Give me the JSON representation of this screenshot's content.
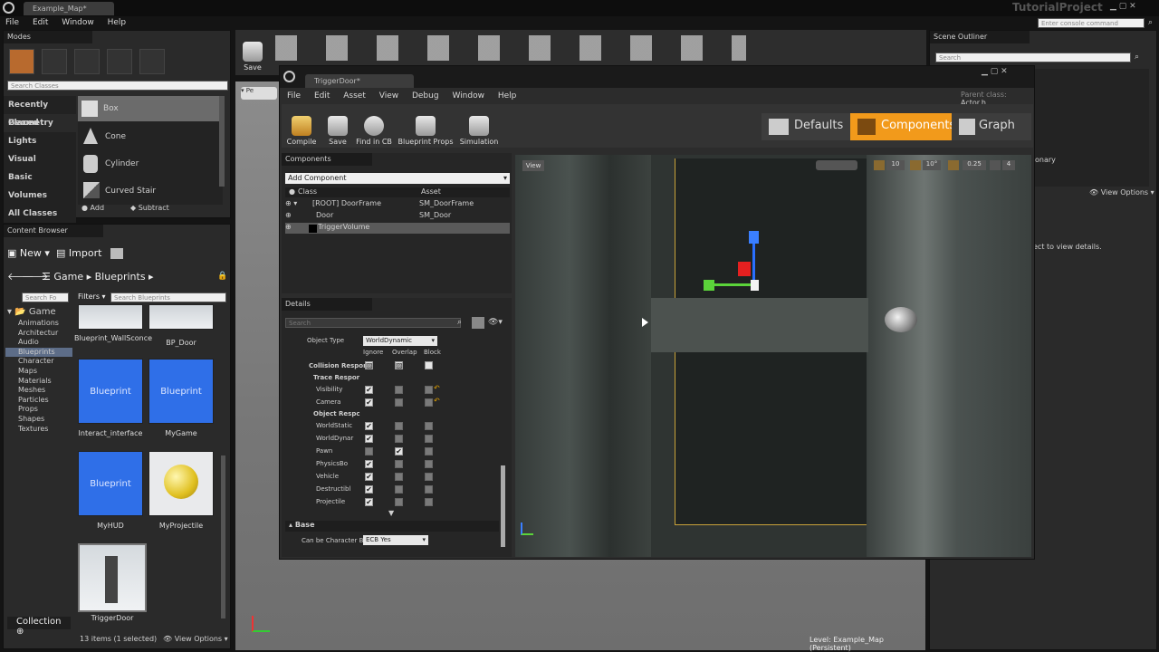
{
  "app": {
    "tab_title": "Example_Map*",
    "project": "TutorialProject",
    "console_placeholder": "Enter console command"
  },
  "main_menu": [
    "File",
    "Edit",
    "Window",
    "Help"
  ],
  "modes": {
    "title": "Modes",
    "search_placeholder": "Search Classes",
    "categories": [
      "Recently Placed",
      "Geometry",
      "Lights",
      "Visual",
      "Basic",
      "Volumes",
      "All Classes"
    ],
    "items": [
      "Box",
      "Cone",
      "Cylinder",
      "Curved Stair"
    ],
    "add_label": "Add",
    "subtract_label": "Subtract"
  },
  "toolbar": {
    "save_label": "Save"
  },
  "content_browser": {
    "title": "Content Browser",
    "new_label": "New",
    "import_label": "Import",
    "path": [
      "Game",
      "Blueprints"
    ],
    "search_placeholder": "Search Fo",
    "filters_label": "Filters",
    "filter_search_placeholder": "Search Blueprints",
    "folders": [
      "Game",
      "Animations",
      "Architectur",
      "Audio",
      "Blueprints",
      "Character",
      "Maps",
      "Materials",
      "Meshes",
      "Particles",
      "Props",
      "Shapes",
      "Textures"
    ],
    "assets": [
      {
        "label": "Blueprint_WallSconce",
        "thumb": ""
      },
      {
        "label": "BP_Door",
        "thumb": ""
      },
      {
        "label": "Interact_interface",
        "thumb": "Blueprint"
      },
      {
        "label": "MyGame",
        "thumb": "Blueprint"
      },
      {
        "label": "MyHUD",
        "thumb": "Blueprint"
      },
      {
        "label": "MyProjectile",
        "thumb": ""
      },
      {
        "label": "TriggerDoor",
        "thumb": ""
      }
    ],
    "collections_label": "Collection",
    "status": "13 items (1 selected)",
    "view_options": "View Options"
  },
  "outliner": {
    "title": "Scene Outliner",
    "search_placeholder": "Search",
    "partial_text": "onary",
    "view_options": "View Options",
    "details_hint": "ect to view details."
  },
  "viewport": {
    "level_label": "Level:",
    "level_name": "Example_Map (Persistent)"
  },
  "blueprint": {
    "tab_title": "TriggerDoor*",
    "menu": [
      "File",
      "Edit",
      "Asset",
      "View",
      "Debug",
      "Window",
      "Help"
    ],
    "parent_class_label": "Parent class:",
    "parent_class": "Actor.h",
    "toolbar": [
      "Compile",
      "Save",
      "Find in CB",
      "Blueprint Props",
      "Simulation"
    ],
    "modes": [
      "Defaults",
      "Components",
      "Graph"
    ],
    "components": {
      "title": "Components",
      "add_label": "Add Component",
      "col_class": "Class",
      "col_asset": "Asset",
      "rows": [
        {
          "name": "[ROOT] DoorFrame",
          "asset": "SM_DoorFrame"
        },
        {
          "name": "Door",
          "asset": "SM_Door"
        },
        {
          "name": "TriggerVolume",
          "asset": ""
        }
      ]
    },
    "details": {
      "title": "Details",
      "search_placeholder": "Search",
      "object_type_label": "Object Type",
      "object_type_value": "WorldDynamic",
      "col_ignore": "Ignore",
      "col_overlap": "Overlap",
      "col_block": "Block",
      "collision_label": "Collision Respon",
      "trace_label": "Trace Respor",
      "object_label": "Object Respc",
      "rows": [
        {
          "label": "Visibility",
          "ignore": true,
          "overlap": false,
          "block": false
        },
        {
          "label": "Camera",
          "ignore": true,
          "overlap": false,
          "block": false
        },
        {
          "label": "WorldStatic",
          "ignore": true,
          "overlap": false,
          "block": false
        },
        {
          "label": "WorldDynar",
          "ignore": true,
          "overlap": false,
          "block": false
        },
        {
          "label": "Pawn",
          "ignore": false,
          "overlap": true,
          "block": false
        },
        {
          "label": "PhysicsBo",
          "ignore": true,
          "overlap": false,
          "block": false
        },
        {
          "label": "Vehicle",
          "ignore": true,
          "overlap": false,
          "block": false
        },
        {
          "label": "Destructibl",
          "ignore": true,
          "overlap": false,
          "block": false
        },
        {
          "label": "Projectile",
          "ignore": true,
          "overlap": false,
          "block": false
        }
      ],
      "base_section": "Base",
      "can_be_char_label": "Can be Character B",
      "can_be_char_value": "ECB Yes"
    },
    "viewport": {
      "view_label": "View",
      "grid": "10",
      "rot": "10°",
      "scale": "0.25",
      "cam": "4"
    }
  }
}
